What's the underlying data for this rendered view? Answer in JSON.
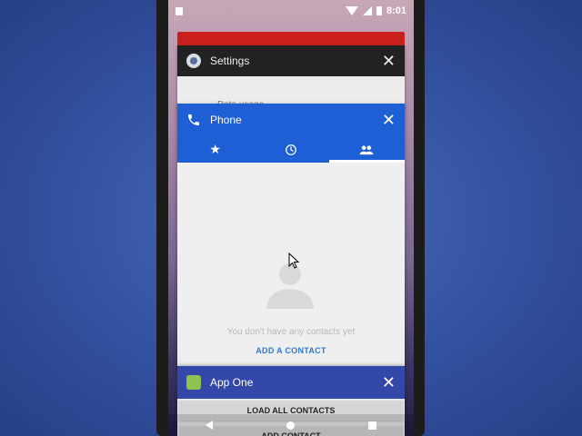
{
  "status_bar": {
    "time": "8:01"
  },
  "recent_apps": [
    {
      "title": "Settings",
      "line1": "",
      "line2": "Data usage"
    },
    {
      "title": "Phone"
    },
    {
      "title": "App One"
    }
  ],
  "phone": {
    "tabs": [
      {
        "name": "favorites",
        "icon": "star-icon"
      },
      {
        "name": "recents",
        "icon": "clock-icon"
      },
      {
        "name": "contacts",
        "icon": "people-icon",
        "selected": true
      }
    ],
    "empty_message": "You don't have any contacts yet",
    "add_contact_label": "ADD A CONTACT"
  },
  "app_one": {
    "load_all_contacts_label": "LOAD ALL CONTACTS",
    "add_contact_label": "ADD CONTACT"
  },
  "colors": {
    "phone_blue": "#1e5fd6",
    "app_one_indigo": "#3348a8",
    "settings_dark": "#222222",
    "accent_red": "#c9201e"
  }
}
